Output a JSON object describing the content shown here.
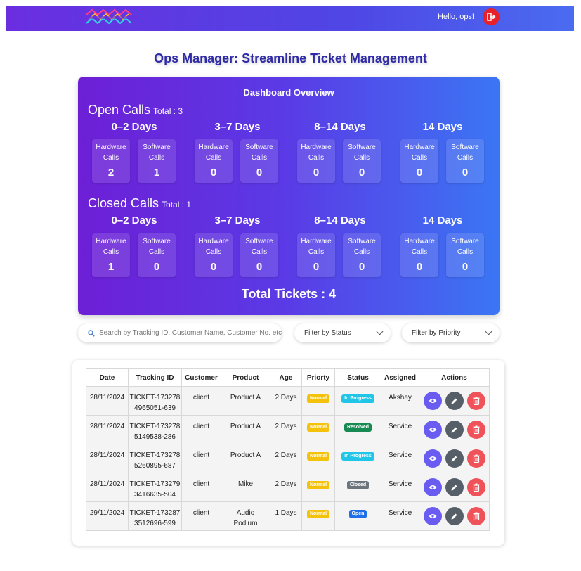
{
  "header": {
    "greeting": "Hello, ops!",
    "logout_icon": "logout-icon",
    "colors": {
      "accent": "#5a3be6",
      "logout": "#e8202a"
    }
  },
  "page_title": "Ops Manager: Streamline Ticket Management",
  "dashboard": {
    "title": "Dashboard Overview",
    "open": {
      "label": "Open Calls",
      "total_label": "Total : 3",
      "buckets": [
        {
          "title": "0–2 Days",
          "hw": "2",
          "sw": "1"
        },
        {
          "title": "3–7 Days",
          "hw": "0",
          "sw": "0"
        },
        {
          "title": "8–14 Days",
          "hw": "0",
          "sw": "0"
        },
        {
          "title": "14 Days",
          "hw": "0",
          "sw": "0"
        }
      ]
    },
    "closed": {
      "label": "Closed Calls",
      "total_label": "Total : 1",
      "buckets": [
        {
          "title": "0–2 Days",
          "hw": "1",
          "sw": "0"
        },
        {
          "title": "3–7 Days",
          "hw": "0",
          "sw": "0"
        },
        {
          "title": "8–14 Days",
          "hw": "0",
          "sw": "0"
        },
        {
          "title": "14 Days",
          "hw": "0",
          "sw": "0"
        }
      ]
    },
    "hw_label_1": "Hardware",
    "sw_label_1": "Software",
    "calls_label": "Calls",
    "total_tickets": "Total Tickets : 4"
  },
  "filters": {
    "search_placeholder": "Search by Tracking ID, Customer Name, Customer No. etc.",
    "status_label": "Filter by Status",
    "priority_label": "Filter by Priority"
  },
  "table": {
    "headers": [
      "Date",
      "Tracking ID",
      "Customer",
      "Product",
      "Age",
      "Priorty",
      "Status",
      "Assigned",
      "Actions"
    ],
    "rows": [
      {
        "date": "28/11/2024",
        "id1": "TICKET-173278",
        "id2": "4965051-639",
        "customer": "client",
        "product1": "Product A",
        "product2": "",
        "age": "2 Days",
        "priority": "Normal",
        "status": "In Progress",
        "assigned": "Akshay"
      },
      {
        "date": "28/11/2024",
        "id1": "TICKET-173278",
        "id2": "5149538-286",
        "customer": "client",
        "product1": "Product A",
        "product2": "",
        "age": "2 Days",
        "priority": "Normal",
        "status": "Resolved",
        "assigned": "Service"
      },
      {
        "date": "28/11/2024",
        "id1": "TICKET-173278",
        "id2": "5260895-687",
        "customer": "client",
        "product1": "Product A",
        "product2": "",
        "age": "2 Days",
        "priority": "Normal",
        "status": "In Progress",
        "assigned": "Service"
      },
      {
        "date": "28/11/2024",
        "id1": "TICKET-173279",
        "id2": "3416635-504",
        "customer": "client",
        "product1": "Mike",
        "product2": "",
        "age": "2 Days",
        "priority": "Normal",
        "status": "Closed",
        "assigned": "Service"
      },
      {
        "date": "29/11/2024",
        "id1": "TICKET-173287",
        "id2": "3512696-599",
        "customer": "client",
        "product1": "Audio",
        "product2": "Podium",
        "age": "1 Days",
        "priority": "Normal",
        "status": "Open",
        "assigned": "Service"
      }
    ],
    "status_colors": {
      "In Progress": "#20c5e8",
      "Resolved": "#168a52",
      "Closed": "#6c757d",
      "Open": "#1f6fe8"
    },
    "priority_color": "#f5c20b",
    "action_colors": {
      "view": "#6a5cf0",
      "edit": "#565e68",
      "delete": "#f0525a"
    },
    "action_icons": [
      "eye-icon",
      "pencil-icon",
      "trash-icon"
    ]
  }
}
